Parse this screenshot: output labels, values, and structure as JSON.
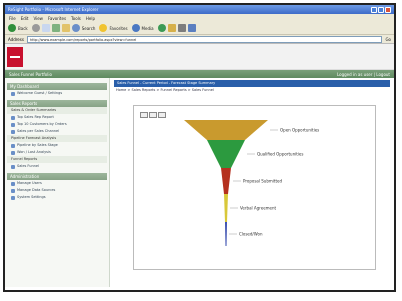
{
  "window": {
    "title": "ReSight Portfolio - Microsoft Internet Explorer"
  },
  "menu": [
    "File",
    "Edit",
    "View",
    "Favorites",
    "Tools",
    "Help"
  ],
  "toolbar": {
    "back": "Back",
    "search": "Search",
    "favorites": "Favorites",
    "media": "Media"
  },
  "address": {
    "label": "Address",
    "value": "http://www.example.com/reports/portfolio.aspx?view=funnel",
    "go": "Go"
  },
  "app": {
    "bar_left": "Sales Funnel Portfolio",
    "bar_right": "Logged in as user | Logout"
  },
  "sidebar": {
    "sections": [
      {
        "title": "My Dashboard",
        "items": [
          {
            "label": "Welcome Guest / Settings"
          }
        ]
      },
      {
        "title": "Sales Reports",
        "items": [
          {
            "label": "Sales & Order Summaries",
            "type": "sub"
          },
          {
            "label": "Top Sales Rep Report"
          },
          {
            "label": "Top 10 Customers by Orders"
          },
          {
            "label": "Sales per Sales Channel"
          },
          {
            "label": "Pipeline Forecast Analysis",
            "type": "sub"
          },
          {
            "label": "Pipeline by Sales Stage"
          },
          {
            "label": "Won / Lost Analysis"
          },
          {
            "label": "Funnel Reports",
            "type": "sub"
          },
          {
            "label": "Sales Funnel"
          }
        ]
      },
      {
        "title": "Administration",
        "items": [
          {
            "label": "Manage Users"
          },
          {
            "label": "Manage Data Sources"
          },
          {
            "label": "System Settings"
          }
        ]
      }
    ]
  },
  "main": {
    "header": "Sales Funnel - Current Period - Forecast Stage Summary",
    "breadcrumb": "Home > Sales Reports > Funnel Reports > Sales Funnel"
  },
  "chart_data": {
    "type": "funnel",
    "stages": [
      {
        "label": "Open Opportunities",
        "color": "#c99a2e"
      },
      {
        "label": "Qualified Opportunities",
        "color": "#2c9a3f"
      },
      {
        "label": "Proposal Submitted",
        "color": "#b5311f"
      },
      {
        "label": "Verbal Agreement",
        "color": "#d8c83a"
      },
      {
        "label": "Closed/Won",
        "color": "#3b4fb0"
      }
    ]
  }
}
